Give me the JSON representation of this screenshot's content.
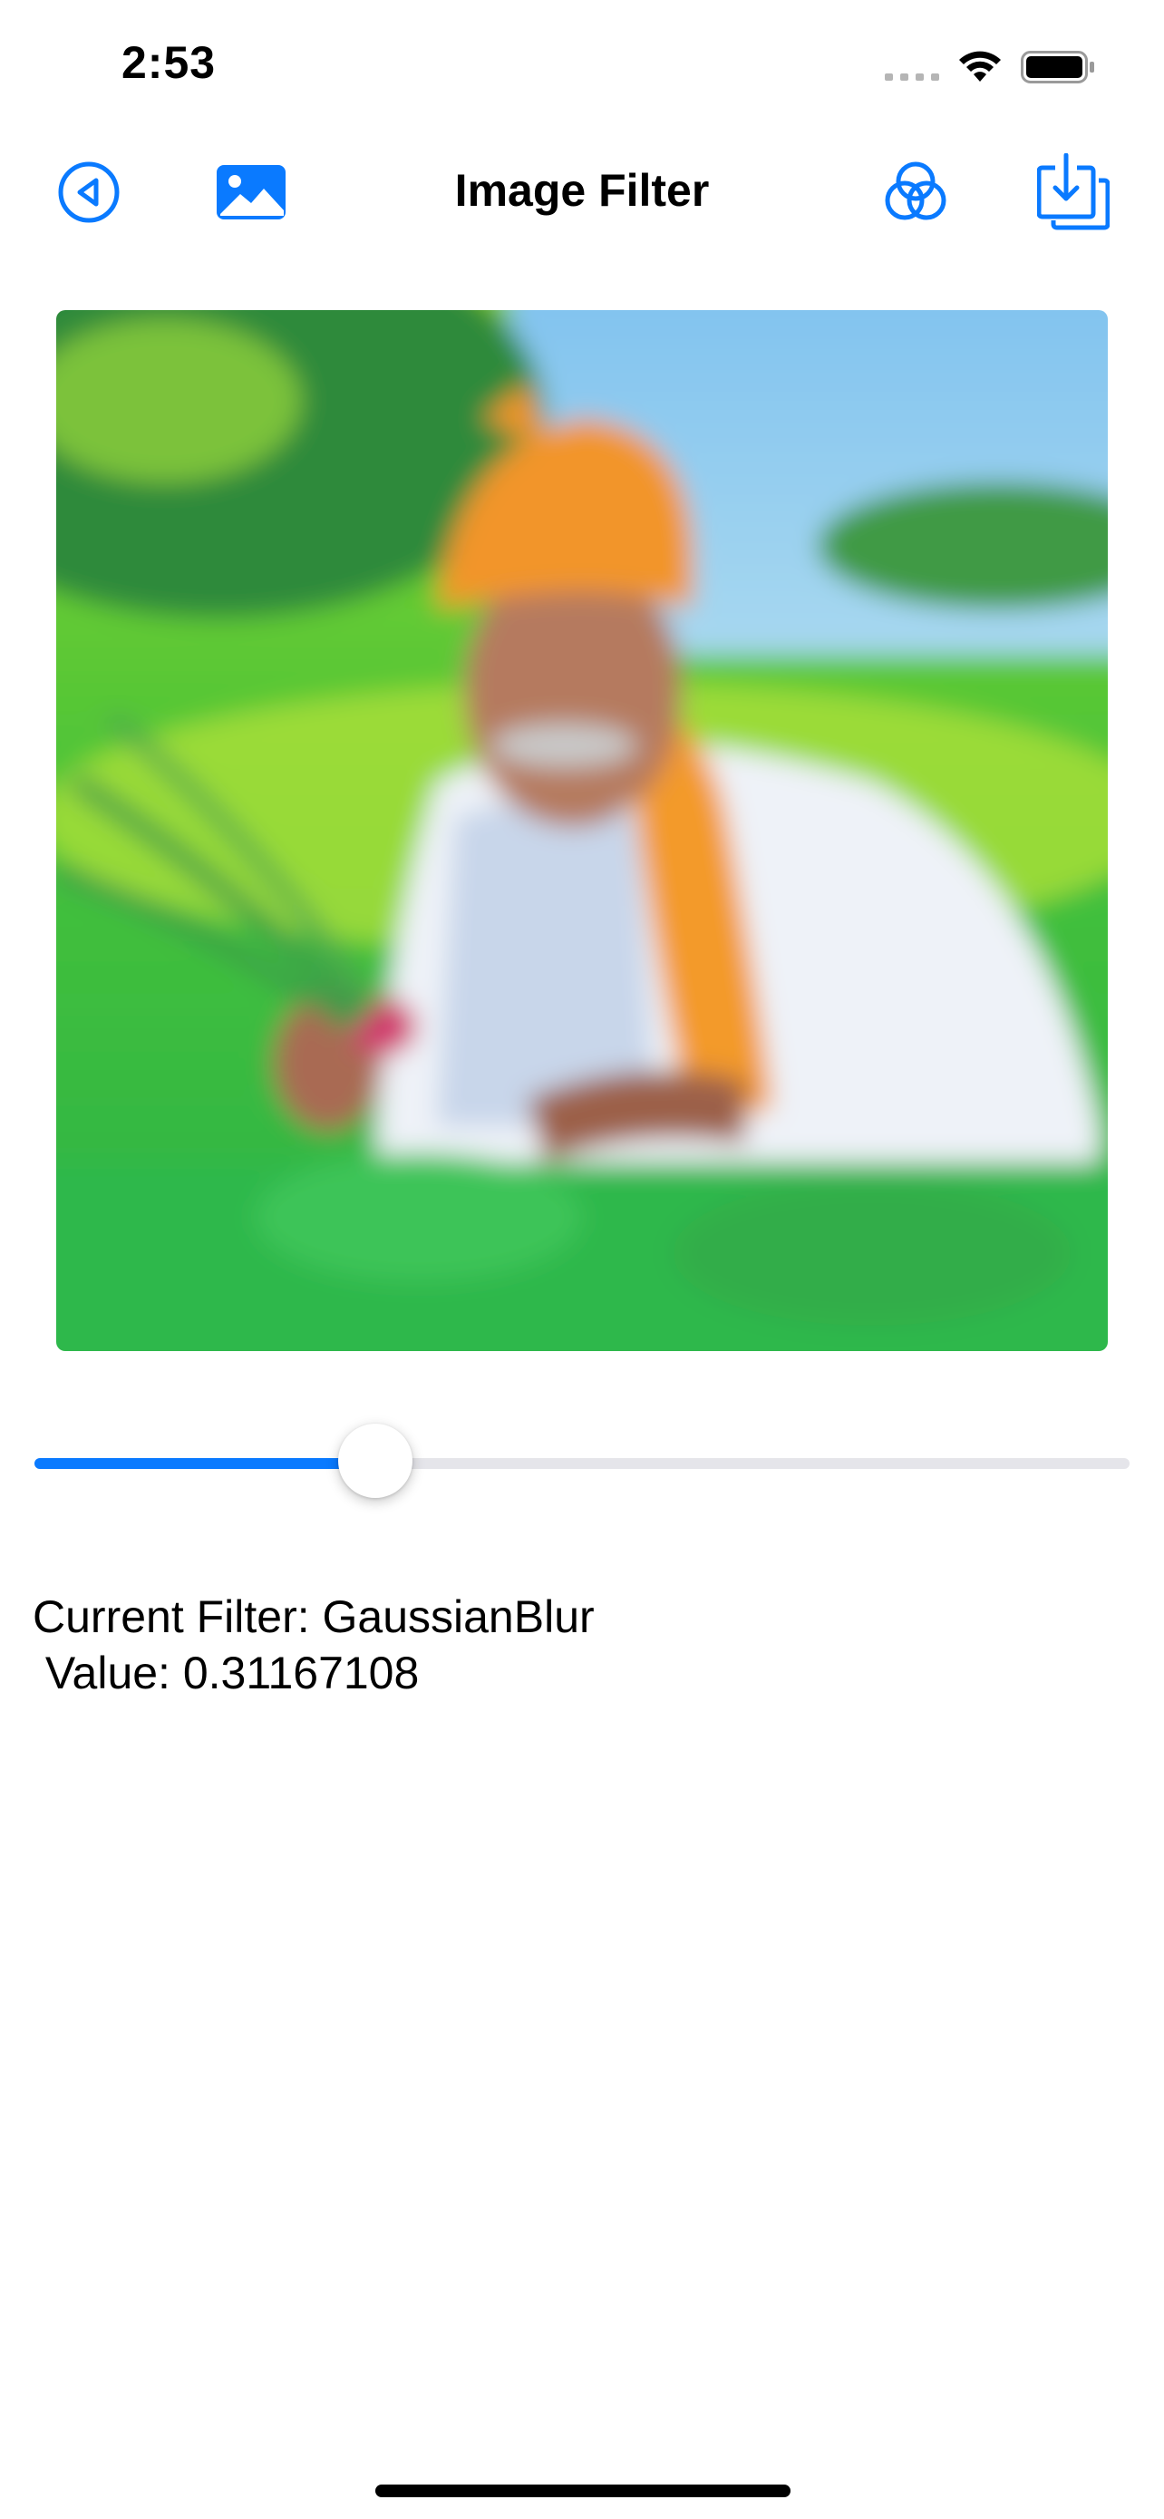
{
  "status_bar": {
    "time": "2:53"
  },
  "nav": {
    "title": "Image Filter",
    "back_icon": "back-circle-icon",
    "photo_icon": "photo-library-icon",
    "filter_icon": "filter-circles-icon",
    "save_icon": "save-download-icon"
  },
  "accent_color": "#0a7aff",
  "slider": {
    "value": 0.31167108
  },
  "info": {
    "filter_line": "Current Filter: GaussianBlur",
    "value_line": " Value: 0.31167108"
  }
}
